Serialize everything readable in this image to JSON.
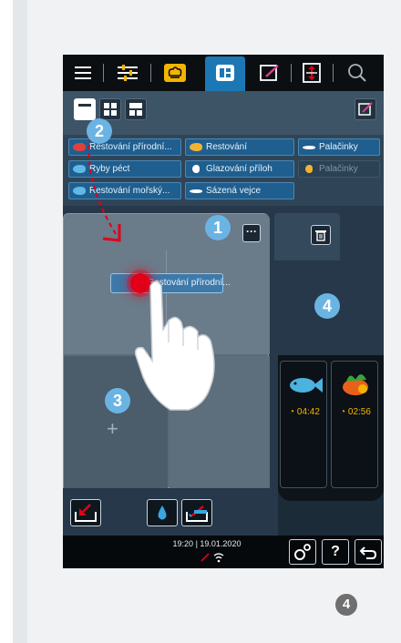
{
  "callouts": [
    "1",
    "2",
    "3",
    "4"
  ],
  "page_number": "4",
  "chips": [
    {
      "label": "Restování přírodní...",
      "icon": "meat-icon",
      "color": "#e0413a"
    },
    {
      "label": "Restování",
      "icon": "poultry-icon",
      "color": "#f2b232"
    },
    {
      "label": "Palačinky",
      "icon": "egg-icon",
      "color": "#ffffff"
    },
    {
      "label": "Ryby péct",
      "icon": "fish-icon",
      "color": "#5fb8e6"
    },
    {
      "label": "Glazování příloh",
      "icon": "side-dish-icon",
      "color": "#ffffff"
    },
    {
      "label": "Palačinky",
      "icon": "pancake-icon",
      "color": "#f2b232"
    },
    {
      "label": "Restování mořský...",
      "icon": "seafood-icon",
      "color": "#5fb8e6"
    },
    {
      "label": "Sázená vejce",
      "icon": "fried-egg-icon",
      "color": "#ffffff"
    }
  ],
  "drag_chip": "Restování přírodní...",
  "timers": [
    {
      "label": "04:42",
      "icon": "fish-icon"
    },
    {
      "label": "02:56",
      "icon": "vegetables-icon"
    }
  ],
  "status": {
    "time": "19:20",
    "date": "19.01.2020"
  },
  "colors": {
    "accent": "#1c78b4",
    "callout": "#6ab4e4",
    "alert": "#e10018",
    "timer": "#f4b400"
  }
}
